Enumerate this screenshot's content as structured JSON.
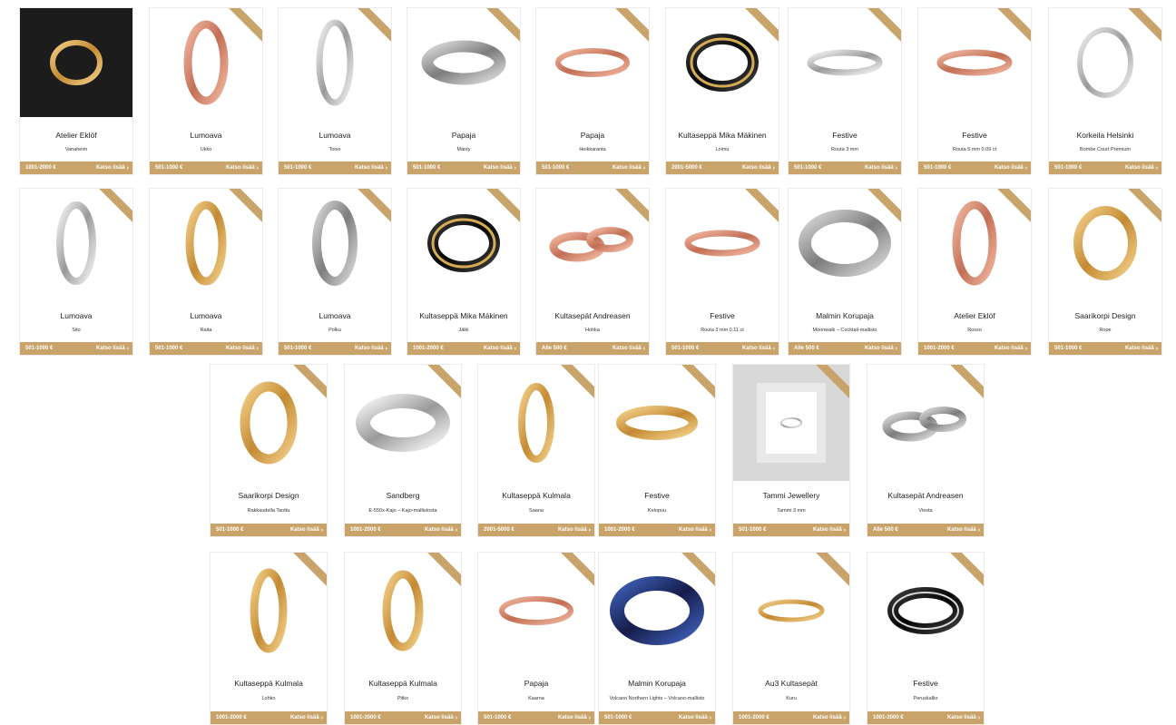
{
  "colors": {
    "accent": "#c9a46a",
    "card_border": "#ececec"
  },
  "products": [
    {
      "maker": "Atelier Eklöf",
      "model": "Vanaheim",
      "price": "1001-2000 €",
      "cta": "Katso lisää",
      "image": "ring-in-box-photo"
    },
    {
      "maker": "Lumoava",
      "model": "Ukko",
      "price": "501-1000 €",
      "cta": "Katso lisää",
      "image": "rose-gold-ring"
    },
    {
      "maker": "Lumoava",
      "model": "Toivo",
      "price": "501-1000 €",
      "cta": "Katso lisää",
      "image": "twisted-silver-ring"
    },
    {
      "maker": "Papaja",
      "model": "Mänty",
      "price": "501-1000 €",
      "cta": "Katso lisää",
      "image": "textured-silver-band"
    },
    {
      "maker": "Papaja",
      "model": "Heikkaranta",
      "price": "501-1000 €",
      "cta": "Katso lisää",
      "image": "rose-gold-band"
    },
    {
      "maker": "Kultaseppä Mika Mäkinen",
      "model": "Loimu",
      "price": "2001-5000 €",
      "cta": "Katso lisää",
      "image": "black-gold-ring"
    },
    {
      "maker": "Festive",
      "model": "Routa 3 mm",
      "price": "501-1000 €",
      "cta": "Katso lisää",
      "image": "patterned-silver-band"
    },
    {
      "maker": "Festive",
      "model": "Routa 5 mm 0.09 ct",
      "price": "501-1000 €",
      "cta": "Katso lisää",
      "image": "patterned-rose-band"
    },
    {
      "maker": "Korkeila Helsinki",
      "model": "Bombe Court Premium",
      "price": "501-1000 €",
      "cta": "Katso lisää",
      "image": "silver-court-ring"
    },
    {
      "maker": "Lumoava",
      "model": "Sito",
      "price": "501-1000 €",
      "cta": "Katso lisää",
      "image": "silver-ring"
    },
    {
      "maker": "Lumoava",
      "model": "Raita",
      "price": "501-1000 €",
      "cta": "Katso lisää",
      "image": "gold-diamond-ring"
    },
    {
      "maker": "Lumoava",
      "model": "Polku",
      "price": "501-1000 €",
      "cta": "Katso lisää",
      "image": "hammered-silver-ring"
    },
    {
      "maker": "Kultaseppä Mika Mäkinen",
      "model": "Jälki",
      "price": "1001-2000 €",
      "cta": "Katso lisää",
      "image": "black-gold-ring"
    },
    {
      "maker": "Kultasepät Andreasen",
      "model": "Hohka",
      "price": "Alle 500 €",
      "cta": "Katso lisää",
      "image": "ring-pair-rose"
    },
    {
      "maker": "Festive",
      "model": "Routa 3 mm 0.11 ct",
      "price": "501-1000 €",
      "cta": "Katso lisää",
      "image": "patterned-rose-band"
    },
    {
      "maker": "Malmin Korupaja",
      "model": "Moonwalk – Cocktail-mallisto",
      "price": "Alle 500 €",
      "cta": "Katso lisää",
      "image": "wide-steel-ring"
    },
    {
      "maker": "Atelier Eklöf",
      "model": "Rosso",
      "price": "1001-2000 €",
      "cta": "Katso lisää",
      "image": "rose-gold-ring"
    },
    {
      "maker": "Saarikorpi Design",
      "model": "Rope",
      "price": "501-1000 €",
      "cta": "Katso lisää",
      "image": "twisted-gold-ring"
    },
    {
      "maker": "Saarikorpi Design",
      "model": "Rakkaudella Taottu",
      "price": "501-1000 €",
      "cta": "Katso lisää",
      "image": "hammered-gold-ring"
    },
    {
      "maker": "Sandberg",
      "model": "E-550x-Kajo – Kajo-mallistosta",
      "price": "1001-2000 €",
      "cta": "Katso lisää",
      "image": "wide-silver-band"
    },
    {
      "maker": "Kultaseppä Kulmala",
      "model": "Saana",
      "price": "2001-5000 €",
      "cta": "Katso lisää",
      "image": "gold-ring"
    },
    {
      "maker": "Festive",
      "model": "Kelopuu",
      "price": "1001-2000 €",
      "cta": "Katso lisää",
      "image": "hammered-gold-band"
    },
    {
      "maker": "Tammi Jewellery",
      "model": "Tammi 3 mm",
      "price": "501-1000 €",
      "cta": "Katso lisää",
      "image": "framed-silver-ring"
    },
    {
      "maker": "Kultasepät Andreasen",
      "model": "Viesta",
      "price": "Alle 500 €",
      "cta": "Katso lisää",
      "image": "ring-pair-silver"
    },
    {
      "maker": "Kultaseppä Kulmala",
      "model": "Lohko",
      "price": "1001-2000 €",
      "cta": "Katso lisää",
      "image": "textured-gold-ring"
    },
    {
      "maker": "Kultaseppä Kulmala",
      "model": "Pitko",
      "price": "1001-2000 €",
      "cta": "Katso lisää",
      "image": "braided-gold-ring"
    },
    {
      "maker": "Papaja",
      "model": "Kaarna",
      "price": "501-1000 €",
      "cta": "Katso lisää",
      "image": "rose-gold-band"
    },
    {
      "maker": "Malmin Korupaja",
      "model": "Volcano Northern Lights – Volcano-mallisto",
      "price": "501-1000 €",
      "cta": "Katso lisää",
      "image": "blue-wide-band"
    },
    {
      "maker": "Au3 Kultasepät",
      "model": "Kuru",
      "price": "1001-2000 €",
      "cta": "Katso lisää",
      "image": "two-tone-ring"
    },
    {
      "maker": "Festive",
      "model": "Peruskallio",
      "price": "1001-2000 €",
      "cta": "Katso lisää",
      "image": "dark-silver-band"
    }
  ]
}
